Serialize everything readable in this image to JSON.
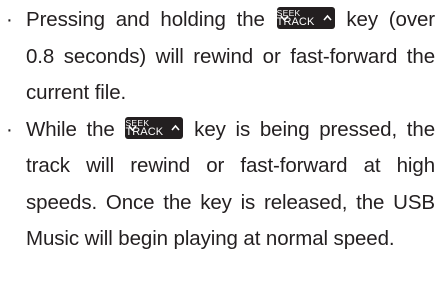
{
  "instructions": {
    "bullet_symbol": "·",
    "key_label": {
      "top": "SEEK",
      "bottom": "TRACK"
    },
    "items": [
      {
        "before": "Pressing and holding the ",
        "after": " key (over 0.8 seconds) will rewind or fast-forward the current file."
      },
      {
        "before": "While the ",
        "after": " key is being pressed, the track will rewind or fast-forward at high speeds. Once the key is released, the USB Music will begin playing at normal speed."
      }
    ]
  }
}
